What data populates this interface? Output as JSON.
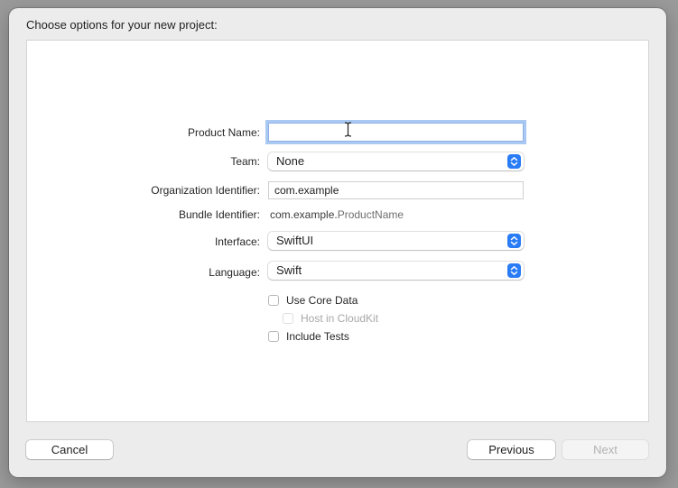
{
  "header": {
    "title": "Choose options for your new project:"
  },
  "form": {
    "product_name": {
      "label": "Product Name:",
      "value": ""
    },
    "team": {
      "label": "Team:",
      "value": "None"
    },
    "organization_identifier": {
      "label": "Organization Identifier:",
      "value": "com.example"
    },
    "bundle_identifier": {
      "label": "Bundle Identifier:",
      "prefix": "com.example.",
      "suffix": "ProductName"
    },
    "interface": {
      "label": "Interface:",
      "value": "SwiftUI"
    },
    "language": {
      "label": "Language:",
      "value": "Swift"
    },
    "checkboxes": {
      "use_core_data": {
        "label": "Use Core Data",
        "checked": false
      },
      "host_in_cloudkit": {
        "label": "Host in CloudKit",
        "checked": false,
        "disabled": true
      },
      "include_tests": {
        "label": "Include Tests",
        "checked": false
      }
    }
  },
  "footer": {
    "cancel_label": "Cancel",
    "previous_label": "Previous",
    "next_label": "Next"
  },
  "colors": {
    "accent": "#2a7cf6",
    "focus_ring": "#a9c9f3",
    "window_bg": "#ececec"
  },
  "icons": {
    "popup_indicator": "chevron-up-down-icon",
    "cursor": "i-beam-cursor-icon"
  }
}
